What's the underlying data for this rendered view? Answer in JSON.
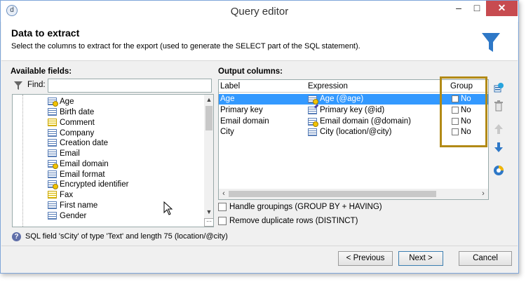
{
  "window": {
    "title": "Query editor",
    "icon_glyph": "d",
    "minimize_glyph": "–",
    "maximize_glyph": "□",
    "close_glyph": "✕"
  },
  "header": {
    "title": "Data to extract",
    "description": "Select the columns to extract for the export (used to generate the SELECT part of the SQL statement)."
  },
  "available_fields": {
    "title": "Available fields:",
    "find_label": "Find:",
    "find_value": "",
    "items": [
      {
        "label": "Age",
        "icon": "calculated-field-icon"
      },
      {
        "label": "Birth date",
        "icon": "field-icon"
      },
      {
        "label": "Comment",
        "icon": "memo-field-icon"
      },
      {
        "label": "Company",
        "icon": "field-icon"
      },
      {
        "label": "Creation date",
        "icon": "field-icon"
      },
      {
        "label": "Email",
        "icon": "field-icon"
      },
      {
        "label": "Email domain",
        "icon": "calculated-field-icon"
      },
      {
        "label": "Email format",
        "icon": "field-icon"
      },
      {
        "label": "Encrypted identifier",
        "icon": "calculated-field-icon"
      },
      {
        "label": "Fax",
        "icon": "memo-field-icon"
      },
      {
        "label": "First name",
        "icon": "field-icon"
      },
      {
        "label": "Gender",
        "icon": "field-icon"
      }
    ]
  },
  "output_columns": {
    "title": "Output columns:",
    "headers": {
      "label": "Label",
      "expression": "Expression",
      "group": "Group"
    },
    "rows": [
      {
        "label": "Age",
        "expression": "Age (@age)",
        "group": "No",
        "selected": true,
        "icon": "calculated-field-icon"
      },
      {
        "label": "Primary key",
        "expression": "Primary key (@id)",
        "group": "No",
        "selected": false,
        "icon": "edit-field-icon"
      },
      {
        "label": "Email domain",
        "expression": "Email domain (@domain)",
        "group": "No",
        "selected": false,
        "icon": "calculated-field-icon"
      },
      {
        "label": "City",
        "expression": "City (location/@city)",
        "group": "No",
        "selected": false,
        "icon": "field-icon"
      }
    ]
  },
  "options": {
    "handle_groupings": "Handle groupings (GROUP BY + HAVING)",
    "remove_duplicates": "Remove duplicate rows (DISTINCT)"
  },
  "status": {
    "info": "SQL field 'sCity' of type 'Text' and length 75 (location/@city)"
  },
  "footer": {
    "previous": "< Previous",
    "next": "Next >",
    "cancel": "Cancel"
  },
  "colors": {
    "accent": "#3399ff",
    "highlight_border": "#b28a16",
    "funnel": "#2e78c7",
    "close_button": "#c74b50"
  }
}
